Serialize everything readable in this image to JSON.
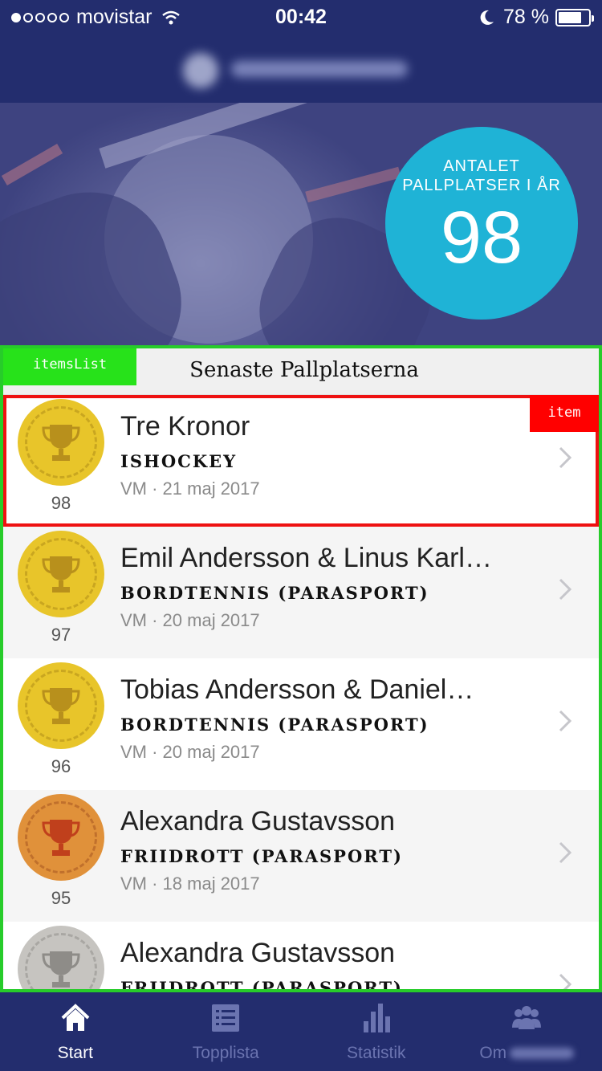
{
  "status_bar": {
    "carrier": "movistar",
    "time": "00:42",
    "battery_percent": "78 %",
    "battery_level": 0.78
  },
  "hero": {
    "counter_label": "ANTALET PALLPLATSER I ÅR",
    "counter_value": "98"
  },
  "list": {
    "tag": "itemsList",
    "title": "Senaste Pallplatserna",
    "item_tag": "item",
    "items": [
      {
        "rank": "98",
        "name": "Tre Kronor",
        "sport": "ISHOCKEY",
        "meta": "VM · 21 maj 2017",
        "medal": "gold-medal-icon",
        "medal_color": "#e8c52a"
      },
      {
        "rank": "97",
        "name": "Emil Andersson & Linus Karl…",
        "sport": "BORDTENNIS (PARASPORT)",
        "meta": "VM · 20 maj 2017",
        "medal": "gold-medal-icon",
        "medal_color": "#e8c52a"
      },
      {
        "rank": "96",
        "name": "Tobias Andersson & Daniel…",
        "sport": "BORDTENNIS (PARASPORT)",
        "meta": "VM · 20 maj 2017",
        "medal": "gold-medal-icon",
        "medal_color": "#e8c52a"
      },
      {
        "rank": "95",
        "name": "Alexandra Gustavsson",
        "sport": "FRIIDROTT (PARASPORT)",
        "meta": "VM · 18 maj 2017",
        "medal": "bronze-medal-icon",
        "medal_color": "#e0913a"
      },
      {
        "rank": "",
        "name": "Alexandra Gustavsson",
        "sport": "FRIIDROTT (PARASPORT)",
        "meta": "",
        "medal": "silver-medal-icon",
        "medal_color": "#c6c4c0"
      }
    ]
  },
  "tabs": [
    {
      "label": "Start",
      "icon": "home-icon",
      "active": true
    },
    {
      "label": "Topplista",
      "icon": "list-icon",
      "active": false
    },
    {
      "label": "Statistik",
      "icon": "bar-chart-icon",
      "active": false
    },
    {
      "label": "Om",
      "icon": "people-icon",
      "active": false
    }
  ],
  "colors": {
    "brand_navy": "#232d6e",
    "counter_cyan": "#1fb3d6",
    "list_outline": "#27cc2a",
    "item_outline": "#ee1111"
  }
}
